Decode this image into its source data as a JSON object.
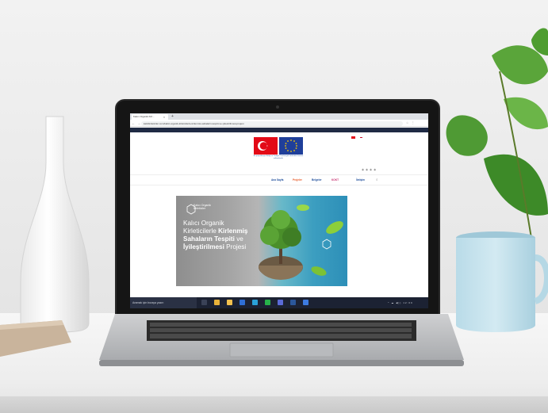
{
  "browser": {
    "tab_title": "Kalıcı Organik Kirl...",
    "tab_close": "×",
    "new_tab": "+",
    "nav_icons": "← → ⟳",
    "url": "kalicikirleticiler.com/kalici-organik-kirleticilerle-kirlenmis-sahalarin-tespiti-ve-iyilestirilmesi-projesi",
    "url_actions": "☆ ⋮"
  },
  "site": {
    "logo_caption": "Bu proje Avrupa Birliği ve Türkiye Cumhuriyeti tarafından finanse edilmektedir.",
    "social": "◉ ◉ ◉ ◉",
    "nav": {
      "items": [
        {
          "label": "Ana Sayfa"
        },
        {
          "label": "Projeler"
        },
        {
          "label": "Belgeler"
        },
        {
          "label": "KOKT"
        },
        {
          "label": "İletişim"
        }
      ],
      "search_icon": "⌕"
    },
    "hero": {
      "logo_text": "Kalıcı Organik Kirleticiler",
      "title_line1": "Kalıcı Organik",
      "title_line2a": "Kirleticilerle ",
      "title_line2b": "Kirlenmiş",
      "title_line3a": "Sahaların Tespiti",
      "title_line3b": " ve",
      "title_line4a": "İyileştirilmesi",
      "title_line4b": " Projesi"
    }
  },
  "taskbar": {
    "search_placeholder": "Aramak için buraya yazın",
    "tray": "^ ☁ ◀)) 12:00"
  },
  "colors": {
    "nav_link": "#1f4e9b",
    "nav_active": "#e85d2a",
    "topbar": "#1f2a44",
    "taskbar": "#1c2233"
  }
}
